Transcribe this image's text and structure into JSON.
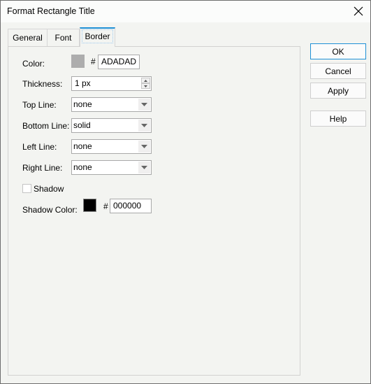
{
  "window": {
    "title": "Format Rectangle Title",
    "close_icon": "close-x-icon"
  },
  "tabs": [
    {
      "label": "General",
      "active": false
    },
    {
      "label": "Font",
      "active": false
    },
    {
      "label": "Border",
      "active": true
    }
  ],
  "border": {
    "color": {
      "label": "Color:",
      "swatch": "#ADADAD",
      "hash": "#",
      "value": "ADADAD"
    },
    "thickness": {
      "label": "Thickness:",
      "value": "1 px"
    },
    "top_line": {
      "label": "Top Line:",
      "value": "none"
    },
    "bottom_line": {
      "label": "Bottom Line:",
      "value": "solid"
    },
    "left_line": {
      "label": "Left Line:",
      "value": "none"
    },
    "right_line": {
      "label": "Right Line:",
      "value": "none"
    },
    "shadow": {
      "label": "Shadow",
      "checked": false
    },
    "shadow_color": {
      "label": "Shadow Color:",
      "swatch": "#000000",
      "hash": "#",
      "value": "000000"
    }
  },
  "buttons": {
    "ok": "OK",
    "cancel": "Cancel",
    "apply": "Apply",
    "help": "Help"
  },
  "colors": {
    "accent": "#1E90D6"
  }
}
